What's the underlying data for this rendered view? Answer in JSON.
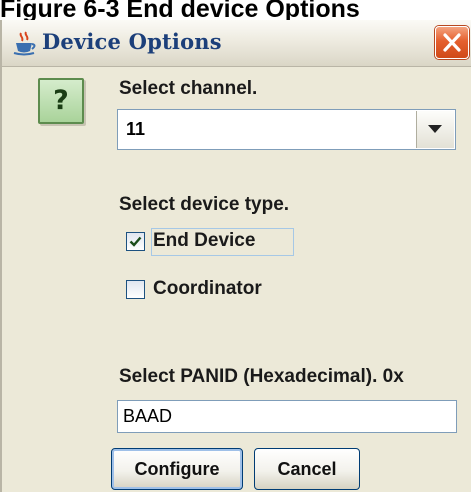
{
  "caption": "Figure 6-3 End device Options",
  "window": {
    "title": "Device Options",
    "icons": {
      "app": "java-cup-icon",
      "close": "close-icon",
      "help": "question-mark-icon"
    }
  },
  "help_glyph": "?",
  "channel": {
    "label": "Select channel.",
    "selected": "11"
  },
  "device_type": {
    "label": "Select device type.",
    "options": [
      {
        "label": "End Device",
        "checked": true
      },
      {
        "label": "Coordinator",
        "checked": false
      }
    ]
  },
  "panid": {
    "label": "Select PANID (Hexadecimal). 0x",
    "value": "BAAD"
  },
  "buttons": {
    "configure": "Configure",
    "cancel": "Cancel"
  },
  "colors": {
    "dialog_bg": "#ece9d8",
    "title_text": "#1c3f7a",
    "close_red": "#e5602f",
    "help_green": "#a9d39a"
  }
}
